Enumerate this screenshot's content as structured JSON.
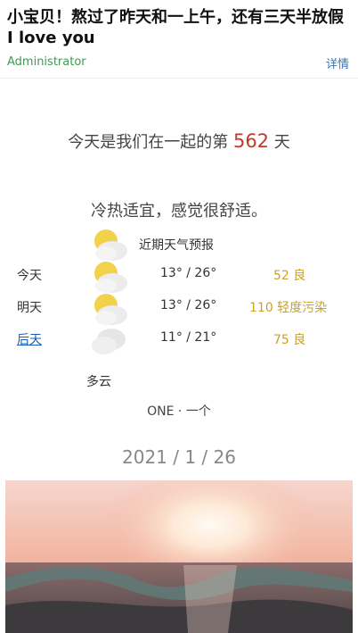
{
  "article": {
    "title": "小宝贝！熬过了昨天和一上午，还有三天半放假 I love you",
    "author": "Administrator",
    "detail_link": "详情"
  },
  "together": {
    "prefix": "今天是我们在一起的第",
    "days": "562",
    "suffix": "天"
  },
  "comfort_text": "冷热适宜，感觉很舒适。",
  "forecast": {
    "title": "近期天气预报",
    "days": [
      {
        "day": "今天",
        "temp": "13° / 26°",
        "aqi": "52 良",
        "icon": "partly-cloudy-icon"
      },
      {
        "day": "明天",
        "temp": "13° / 26°",
        "aqi": "110 轻度污染",
        "icon": "partly-cloudy-icon"
      },
      {
        "day": "后天",
        "temp": "11° / 21°",
        "aqi": "75 良",
        "icon": "cloudy-icon"
      }
    ],
    "condition": "多云"
  },
  "one_label": "ONE · 一个",
  "date": "2021 / 1 / 26",
  "colors": {
    "accent_red": "#c0392b",
    "aqi_gold": "#c9a227",
    "author_green": "#3f9a55",
    "link_blue": "#3b74b8"
  }
}
